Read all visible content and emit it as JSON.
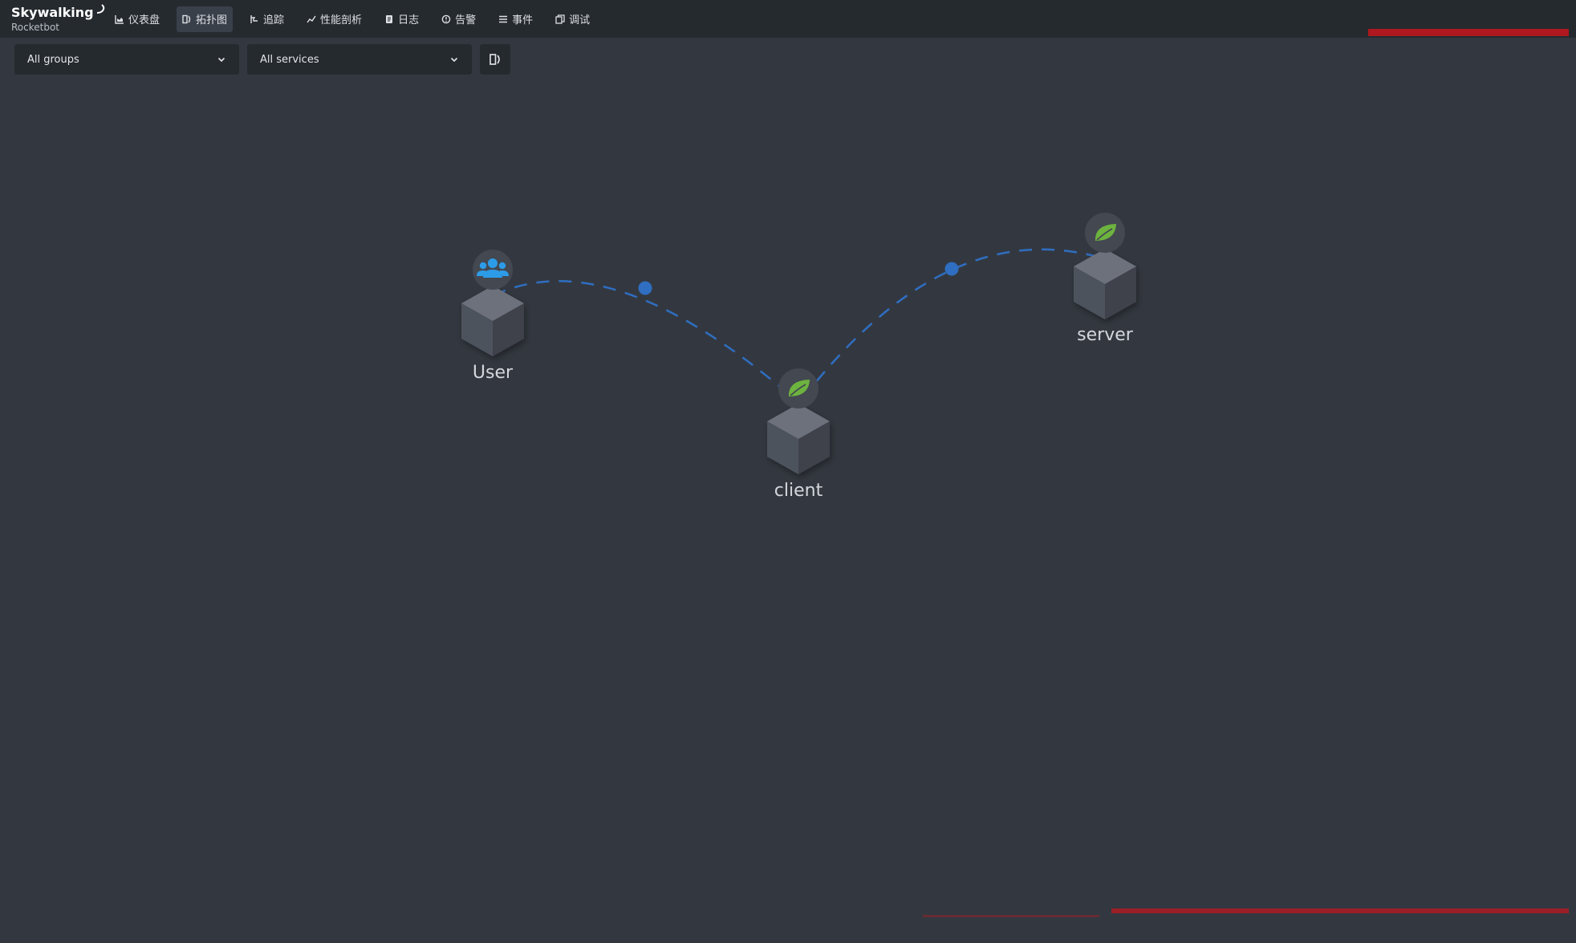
{
  "app": {
    "logo_main": "Skywalking",
    "logo_sub": "Rocketbot"
  },
  "nav": {
    "items": [
      {
        "label": "仪表盘",
        "icon": "dashboard-icon"
      },
      {
        "label": "拓扑图",
        "icon": "topology-icon",
        "active": true
      },
      {
        "label": "追踪",
        "icon": "trace-icon"
      },
      {
        "label": "性能剖析",
        "icon": "profile-icon"
      },
      {
        "label": "日志",
        "icon": "log-icon"
      },
      {
        "label": "告警",
        "icon": "alarm-icon"
      },
      {
        "label": "事件",
        "icon": "event-icon"
      },
      {
        "label": "调试",
        "icon": "debug-icon"
      }
    ]
  },
  "toolbar": {
    "group_select": "All groups",
    "service_select": "All services"
  },
  "topology": {
    "nodes": [
      {
        "id": "user",
        "label": "User",
        "icon": "users-icon"
      },
      {
        "id": "client",
        "label": "client",
        "icon": "spring-leaf-icon"
      },
      {
        "id": "server",
        "label": "server",
        "icon": "spring-leaf-icon"
      }
    ],
    "links": [
      {
        "source": "user",
        "target": "client"
      },
      {
        "source": "client",
        "target": "server"
      }
    ]
  },
  "colors": {
    "background": "#333840",
    "topbar": "#252a2f",
    "link": "#2f6ec1",
    "spring": "#6db33f",
    "users": "#2d9ce8"
  }
}
